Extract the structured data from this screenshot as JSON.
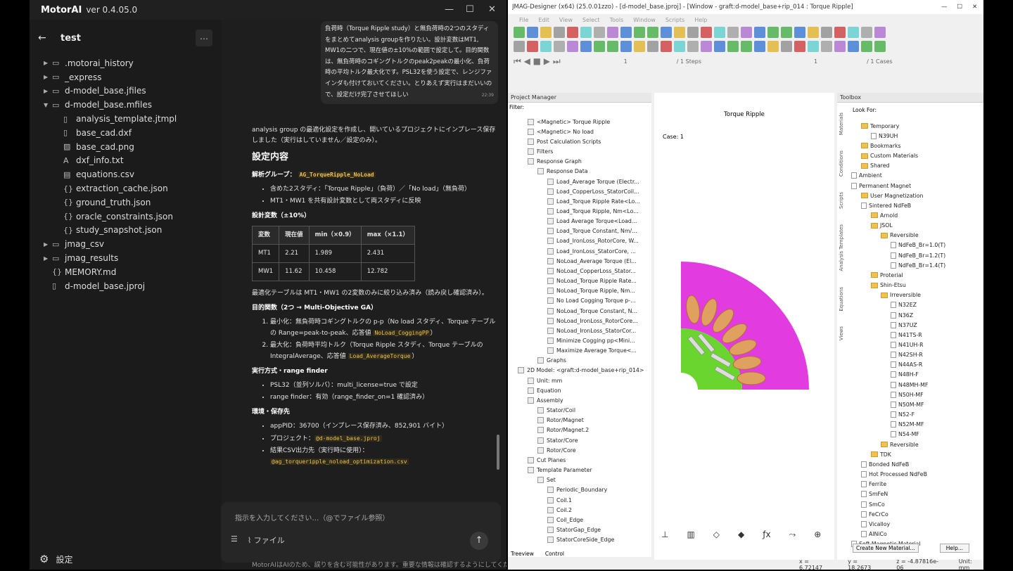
{
  "motorai": {
    "brand": "MotorAI",
    "version": "ver 0.4.05.0",
    "project": "test",
    "tree": [
      {
        "label": ".motorai_history",
        "type": "folder",
        "depth": 0
      },
      {
        "label": "_express",
        "type": "folder",
        "depth": 0
      },
      {
        "label": "d-model_base.jfiles",
        "type": "folder",
        "depth": 0
      },
      {
        "label": "d-model_base.mfiles",
        "type": "folder-open",
        "depth": 0
      },
      {
        "label": "analysis_template.jtmpl",
        "type": "file",
        "depth": 1
      },
      {
        "label": "base_cad.dxf",
        "type": "file",
        "depth": 1
      },
      {
        "label": "base_cad.png",
        "type": "image",
        "depth": 1
      },
      {
        "label": "dxf_info.txt",
        "type": "text",
        "depth": 1
      },
      {
        "label": "equations.csv",
        "type": "table",
        "depth": 1
      },
      {
        "label": "extraction_cache.json",
        "type": "json",
        "depth": 1
      },
      {
        "label": "ground_truth.json",
        "type": "json",
        "depth": 1
      },
      {
        "label": "oracle_constraints.json",
        "type": "json",
        "depth": 1
      },
      {
        "label": "study_snapshot.json",
        "type": "json",
        "depth": 1
      },
      {
        "label": "jmag_csv",
        "type": "folder",
        "depth": 0
      },
      {
        "label": "jmag_results",
        "type": "folder",
        "depth": 0
      },
      {
        "label": "MEMORY.md",
        "type": "json",
        "depth": 0
      },
      {
        "label": "d-model_base.jproj",
        "type": "file",
        "depth": 0
      }
    ],
    "settings": "設定",
    "user_bubble": {
      "text": "負荷時（Torque Ripple study）と無負荷時の2つのスタディをまとめてanalysis groupを作りたい。設計変数はMT1, MW1の二つで、現在値の±10%の範囲で設定して。目的関数は、無負荷時のコギングトルクのpeak2peakの最小化、負荷時の平均トルク最大化です。PSL32を使う設定で、レンジファインダも付けておいてください。とりあえず実行はまだいいので、設定だけ完了させてほしい",
      "time": "22:39"
    },
    "reply": {
      "intro": "analysis group の最適化設定を作成し、開いているプロジェクトにインプレース保存しました（実行はしていません／設定のみ）。",
      "h_settings": "設定内容",
      "group_label": "解析グループ：",
      "group_code": "AG_TorqueRipple_NoLoad",
      "group_items": [
        "含めた2スタディ：「Torque Ripple」（負荷）／「No load」（無負荷）",
        "MT1・MW1 を共有設計変数として両スタディに反映"
      ],
      "var_head": "設計変数（±10%）",
      "table_head": [
        "変数",
        "現在値",
        "min（×0.9）",
        "max（×1.1）"
      ],
      "table_rows": [
        [
          "MT1",
          "2.21",
          "1.989",
          "2.431"
        ],
        [
          "MW1",
          "11.62",
          "10.458",
          "12.782"
        ]
      ],
      "table_note": "最適化テーブルは MT1・MW1 の2変数のみに絞り込み済み（読み戻し確認済み）。",
      "obj_head": "目的関数（2つ → Multi-Objective GA）",
      "obj1_pre": "最小化：無負荷時コギングトルクの p-p（No load スタディ、Torque テーブルの Range=peak-to-peak、応答値 ",
      "obj1_code": "NoLoad_CoggingPP",
      "obj1_post": "）",
      "obj2_pre": "最大化：負荷時平均トルク（Torque Ripple スタディ、Torque テーブルの IntegralAverage、応答値 ",
      "obj2_code": "Load_AverageTorque",
      "obj2_post": "）",
      "exec_head": "実行方式・range finder",
      "exec_items": [
        "PSL32（並列ソルバ）：multi_license=true で設定",
        "range finder：有効（range_finder_on=1 確認済み）"
      ],
      "env_head": "環境・保存先",
      "env1": "appPID：36700（インプレース保存済み、852,901 バイト）",
      "env2_pre": "プロジェクト：",
      "env2_code": "@d-model_base.jproj",
      "env3_pre": "結果CSV出力先（実行時に使用）：",
      "env3_code": "@ag_torqueripple_noload_optimization.csv"
    },
    "input": {
      "placeholder": "指示を入力してください…（@でファイル参照）",
      "file_btn": "ファイル"
    },
    "disclaimer": "MotorAIはAIのため、誤りを含む可能性があります。重要な情報は確認するようにしてください"
  },
  "jmag": {
    "title": "JMAG-Designer (x64) (25.0.01zzo) - [d-model_base.jproj] - [Window - graft:d-model_base+rip_014 : Torque Ripple]",
    "menu": [
      "File",
      "Edit",
      "View",
      "Select",
      "Tools",
      "Window",
      "Scripts",
      "Help"
    ],
    "steps": {
      "value": "1",
      "label": "/ 1 Steps",
      "case_value": "1",
      "case_label": "/ 1 Cases"
    },
    "pm_title": "Project Manager",
    "filter": "Filter:",
    "pm_rows": [
      {
        "t": "<Magnetic> Torque Ripple",
        "d": 2
      },
      {
        "t": "<Magnetic> No load",
        "d": 2
      },
      {
        "t": "Post Calculation Scripts",
        "d": 2
      },
      {
        "t": "Filters",
        "d": 2
      },
      {
        "t": "Response Graph",
        "d": 2
      },
      {
        "t": "Response Data",
        "d": 3
      },
      {
        "t": "Load_Average Torque (Electr...",
        "d": 4
      },
      {
        "t": "Load_CopperLoss_StatorCoil...",
        "d": 4
      },
      {
        "t": "Load_Torque Ripple Rate<Lo...",
        "d": 4
      },
      {
        "t": "Load_Torque Ripple, Nm<Lo...",
        "d": 4
      },
      {
        "t": "Load Average Torque<Load...",
        "d": 4
      },
      {
        "t": "Load_Torque Constant, Nm/...",
        "d": 4
      },
      {
        "t": "Load_IronLoss_RotorCore, W...",
        "d": 4
      },
      {
        "t": "Load_IronLoss_StatorCore, ...",
        "d": 4
      },
      {
        "t": "NoLoad_Average Torque (El...",
        "d": 4
      },
      {
        "t": "NoLoad_CopperLoss_Stator...",
        "d": 4
      },
      {
        "t": "NoLoad_Torque Ripple Rate...",
        "d": 4
      },
      {
        "t": "NoLoad_Torque Ripple, Nm...",
        "d": 4
      },
      {
        "t": "No Load Cogging Torque p-...",
        "d": 4
      },
      {
        "t": "NoLoad_Torque Constant, N...",
        "d": 4
      },
      {
        "t": "NoLoad_IronLoss_RotorCore...",
        "d": 4
      },
      {
        "t": "NoLoad_IronLoss_StatorCor...",
        "d": 4
      },
      {
        "t": "Minimize Cogging pp<Mini...",
        "d": 4
      },
      {
        "t": "Maximize Average Torque<...",
        "d": 4
      },
      {
        "t": "Graphs",
        "d": 3
      },
      {
        "t": "2D Model: <graft:d-model_base+rip_014>",
        "d": 1
      },
      {
        "t": "Unit: mm",
        "d": 2
      },
      {
        "t": "Equation",
        "d": 2
      },
      {
        "t": "Assembly",
        "d": 2
      },
      {
        "t": "Stator/Coil",
        "d": 3
      },
      {
        "t": "Rotor/Magnet",
        "d": 3
      },
      {
        "t": "Rotor/Magnet.2",
        "d": 3
      },
      {
        "t": "Stator/Core",
        "d": 3
      },
      {
        "t": "Rotor/Core",
        "d": 3
      },
      {
        "t": "Cut Planes",
        "d": 2
      },
      {
        "t": "Template Parameter",
        "d": 2
      },
      {
        "t": "Set",
        "d": 3
      },
      {
        "t": "Periodic_Boundary",
        "d": 4
      },
      {
        "t": "Coil.1",
        "d": 4
      },
      {
        "t": "Coil.2",
        "d": 4
      },
      {
        "t": "Coil_Edge",
        "d": 4
      },
      {
        "t": "StatorGap_Edge",
        "d": 4
      },
      {
        "t": "StatorCoreSide_Edge",
        "d": 4
      }
    ],
    "pm_tabs": [
      "Treeview",
      "Control"
    ],
    "view_title": "Torque Ripple",
    "case": "Case: 1",
    "toolbox_title": "Toolbox",
    "lookfor": "Look For:",
    "vtabs": [
      "Materials",
      "Conditions",
      "Scripts",
      "Analysis Templates",
      "Equations",
      "Views"
    ],
    "tbx_rows": [
      {
        "t": "Temporary",
        "d": 1,
        "f": 1
      },
      {
        "t": "N39UH",
        "d": 2,
        "f": 0
      },
      {
        "t": "Bookmarks",
        "d": 1,
        "f": 1
      },
      {
        "t": "Custom Materials",
        "d": 1,
        "f": 1
      },
      {
        "t": "Shared",
        "d": 1,
        "f": 1
      },
      {
        "t": "Ambient",
        "d": 0,
        "f": 0
      },
      {
        "t": "Permanent Magnet",
        "d": 0,
        "f": 0
      },
      {
        "t": "User Magnetization",
        "d": 1,
        "f": 1
      },
      {
        "t": "Sintered NdFeB",
        "d": 1,
        "f": 0
      },
      {
        "t": "Arnold",
        "d": 2,
        "f": 1
      },
      {
        "t": "JSOL",
        "d": 2,
        "f": 1
      },
      {
        "t": "Reversible",
        "d": 3,
        "f": 1
      },
      {
        "t": "NdFeB_Br=1.0(T)",
        "d": 4,
        "f": 0
      },
      {
        "t": "NdFeB_Br=1.2(T)",
        "d": 4,
        "f": 0
      },
      {
        "t": "NdFeB_Br=1.4(T)",
        "d": 4,
        "f": 0
      },
      {
        "t": "Proterial",
        "d": 2,
        "f": 1
      },
      {
        "t": "Shin-Etsu",
        "d": 2,
        "f": 1
      },
      {
        "t": "Irreversible",
        "d": 3,
        "f": 1
      },
      {
        "t": "N32EZ",
        "d": 4,
        "f": 0
      },
      {
        "t": "N36Z",
        "d": 4,
        "f": 0
      },
      {
        "t": "N37UZ",
        "d": 4,
        "f": 0
      },
      {
        "t": "N41TS-R",
        "d": 4,
        "f": 0
      },
      {
        "t": "N41UH-R",
        "d": 4,
        "f": 0
      },
      {
        "t": "N42SH-R",
        "d": 4,
        "f": 0
      },
      {
        "t": "N44AS-R",
        "d": 4,
        "f": 0
      },
      {
        "t": "N48H-F",
        "d": 4,
        "f": 0
      },
      {
        "t": "N48MH-MF",
        "d": 4,
        "f": 0
      },
      {
        "t": "N50H-MF",
        "d": 4,
        "f": 0
      },
      {
        "t": "N50M-MF",
        "d": 4,
        "f": 0
      },
      {
        "t": "N52-F",
        "d": 4,
        "f": 0
      },
      {
        "t": "N52M-MF",
        "d": 4,
        "f": 0
      },
      {
        "t": "N54-MF",
        "d": 4,
        "f": 0
      },
      {
        "t": "Reversible",
        "d": 3,
        "f": 1
      },
      {
        "t": "TDK",
        "d": 2,
        "f": 1
      },
      {
        "t": "Bonded NdFeB",
        "d": 1,
        "f": 0
      },
      {
        "t": "Hot Processed NdFeB",
        "d": 1,
        "f": 0
      },
      {
        "t": "Ferrite",
        "d": 1,
        "f": 0
      },
      {
        "t": "SmFeN",
        "d": 1,
        "f": 0
      },
      {
        "t": "SmCo",
        "d": 1,
        "f": 0
      },
      {
        "t": "FeCrCo",
        "d": 1,
        "f": 0
      },
      {
        "t": "Vicalloy",
        "d": 1,
        "f": 0
      },
      {
        "t": "AlNiCo",
        "d": 1,
        "f": 0
      },
      {
        "t": "Soft Magnetic Material",
        "d": 0,
        "f": 0
      }
    ],
    "create_btn": "Create New Material...",
    "help_btn": "Help...",
    "status": {
      "x": "x = 6.72147",
      "y": "y = 18.2673",
      "z": "z = -4.87816e-06",
      "unit": "Unit: mm"
    }
  }
}
